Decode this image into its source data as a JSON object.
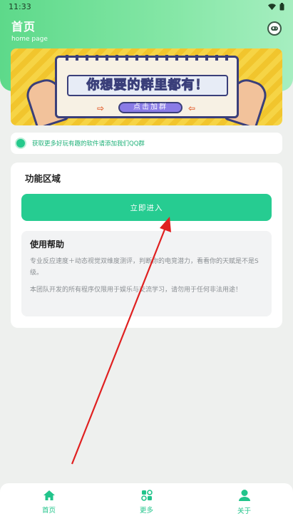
{
  "status_bar": {
    "time": "11:33"
  },
  "header": {
    "title": "首页",
    "subtitle": "home page",
    "right_icon": "game-controller-icon"
  },
  "banner": {
    "headline": "你想要的群里都有！",
    "button_label": "点击加群",
    "arrow_left": "⇨",
    "arrow_right": "⇦"
  },
  "notice": {
    "text": "获取更多好玩有趣的软件请添加我们QQ群"
  },
  "panel": {
    "title": "功能区域",
    "enter_button": "立即进入",
    "help": {
      "title": "使用帮助",
      "paragraph1": "专业反应速度＋动态视觉双维度测评，判断你的电竞潜力，看看你的天赋是不是S级。",
      "paragraph2": "本团队开发的所有程序仅限用于娱乐与交流学习，请勿用于任何非法用途！"
    }
  },
  "bottom_nav": [
    {
      "label": "首页",
      "icon": "home-icon"
    },
    {
      "label": "更多",
      "icon": "grid-icon"
    },
    {
      "label": "关于",
      "icon": "user-icon"
    }
  ],
  "colors": {
    "accent": "#26cc91",
    "header_start": "#5dd98a",
    "annotation": "#e02020"
  }
}
